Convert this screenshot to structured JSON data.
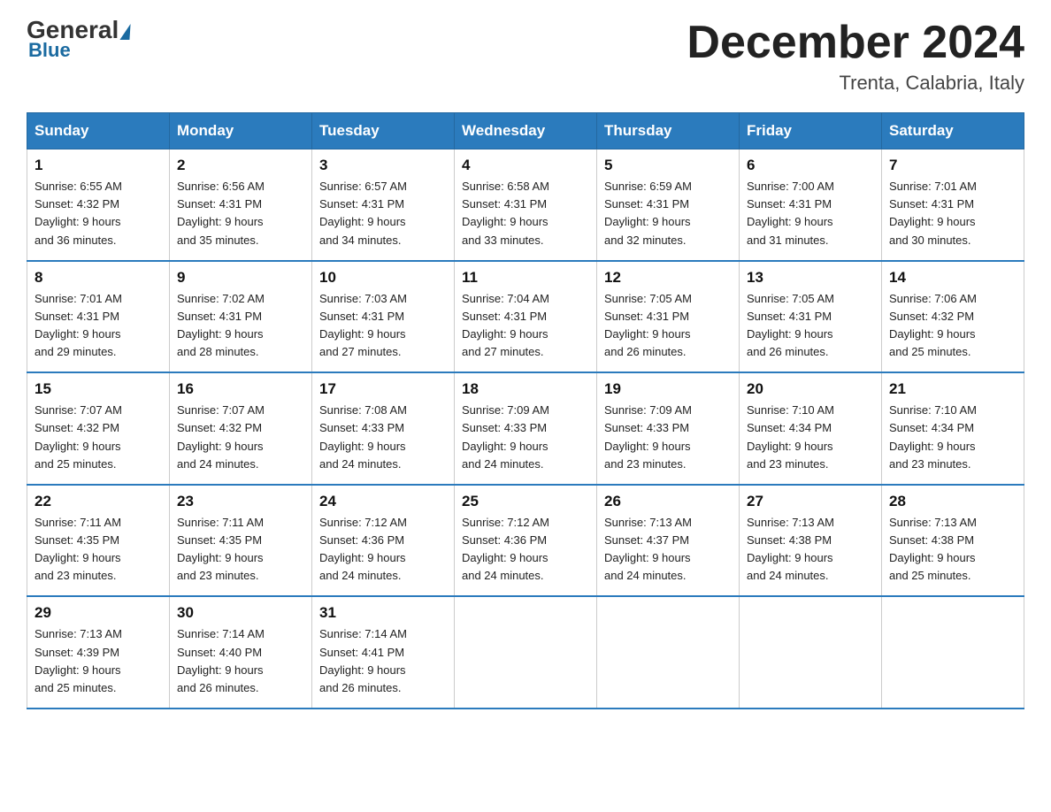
{
  "logo": {
    "general": "General",
    "blue": "Blue",
    "triangle_char": "▶"
  },
  "title": "December 2024",
  "location": "Trenta, Calabria, Italy",
  "days_of_week": [
    "Sunday",
    "Monday",
    "Tuesday",
    "Wednesday",
    "Thursday",
    "Friday",
    "Saturday"
  ],
  "weeks": [
    [
      {
        "day": "1",
        "sunrise": "6:55 AM",
        "sunset": "4:32 PM",
        "daylight": "9 hours and 36 minutes."
      },
      {
        "day": "2",
        "sunrise": "6:56 AM",
        "sunset": "4:31 PM",
        "daylight": "9 hours and 35 minutes."
      },
      {
        "day": "3",
        "sunrise": "6:57 AM",
        "sunset": "4:31 PM",
        "daylight": "9 hours and 34 minutes."
      },
      {
        "day": "4",
        "sunrise": "6:58 AM",
        "sunset": "4:31 PM",
        "daylight": "9 hours and 33 minutes."
      },
      {
        "day": "5",
        "sunrise": "6:59 AM",
        "sunset": "4:31 PM",
        "daylight": "9 hours and 32 minutes."
      },
      {
        "day": "6",
        "sunrise": "7:00 AM",
        "sunset": "4:31 PM",
        "daylight": "9 hours and 31 minutes."
      },
      {
        "day": "7",
        "sunrise": "7:01 AM",
        "sunset": "4:31 PM",
        "daylight": "9 hours and 30 minutes."
      }
    ],
    [
      {
        "day": "8",
        "sunrise": "7:01 AM",
        "sunset": "4:31 PM",
        "daylight": "9 hours and 29 minutes."
      },
      {
        "day": "9",
        "sunrise": "7:02 AM",
        "sunset": "4:31 PM",
        "daylight": "9 hours and 28 minutes."
      },
      {
        "day": "10",
        "sunrise": "7:03 AM",
        "sunset": "4:31 PM",
        "daylight": "9 hours and 27 minutes."
      },
      {
        "day": "11",
        "sunrise": "7:04 AM",
        "sunset": "4:31 PM",
        "daylight": "9 hours and 27 minutes."
      },
      {
        "day": "12",
        "sunrise": "7:05 AM",
        "sunset": "4:31 PM",
        "daylight": "9 hours and 26 minutes."
      },
      {
        "day": "13",
        "sunrise": "7:05 AM",
        "sunset": "4:31 PM",
        "daylight": "9 hours and 26 minutes."
      },
      {
        "day": "14",
        "sunrise": "7:06 AM",
        "sunset": "4:32 PM",
        "daylight": "9 hours and 25 minutes."
      }
    ],
    [
      {
        "day": "15",
        "sunrise": "7:07 AM",
        "sunset": "4:32 PM",
        "daylight": "9 hours and 25 minutes."
      },
      {
        "day": "16",
        "sunrise": "7:07 AM",
        "sunset": "4:32 PM",
        "daylight": "9 hours and 24 minutes."
      },
      {
        "day": "17",
        "sunrise": "7:08 AM",
        "sunset": "4:33 PM",
        "daylight": "9 hours and 24 minutes."
      },
      {
        "day": "18",
        "sunrise": "7:09 AM",
        "sunset": "4:33 PM",
        "daylight": "9 hours and 24 minutes."
      },
      {
        "day": "19",
        "sunrise": "7:09 AM",
        "sunset": "4:33 PM",
        "daylight": "9 hours and 23 minutes."
      },
      {
        "day": "20",
        "sunrise": "7:10 AM",
        "sunset": "4:34 PM",
        "daylight": "9 hours and 23 minutes."
      },
      {
        "day": "21",
        "sunrise": "7:10 AM",
        "sunset": "4:34 PM",
        "daylight": "9 hours and 23 minutes."
      }
    ],
    [
      {
        "day": "22",
        "sunrise": "7:11 AM",
        "sunset": "4:35 PM",
        "daylight": "9 hours and 23 minutes."
      },
      {
        "day": "23",
        "sunrise": "7:11 AM",
        "sunset": "4:35 PM",
        "daylight": "9 hours and 23 minutes."
      },
      {
        "day": "24",
        "sunrise": "7:12 AM",
        "sunset": "4:36 PM",
        "daylight": "9 hours and 24 minutes."
      },
      {
        "day": "25",
        "sunrise": "7:12 AM",
        "sunset": "4:36 PM",
        "daylight": "9 hours and 24 minutes."
      },
      {
        "day": "26",
        "sunrise": "7:13 AM",
        "sunset": "4:37 PM",
        "daylight": "9 hours and 24 minutes."
      },
      {
        "day": "27",
        "sunrise": "7:13 AM",
        "sunset": "4:38 PM",
        "daylight": "9 hours and 24 minutes."
      },
      {
        "day": "28",
        "sunrise": "7:13 AM",
        "sunset": "4:38 PM",
        "daylight": "9 hours and 25 minutes."
      }
    ],
    [
      {
        "day": "29",
        "sunrise": "7:13 AM",
        "sunset": "4:39 PM",
        "daylight": "9 hours and 25 minutes."
      },
      {
        "day": "30",
        "sunrise": "7:14 AM",
        "sunset": "4:40 PM",
        "daylight": "9 hours and 26 minutes."
      },
      {
        "day": "31",
        "sunrise": "7:14 AM",
        "sunset": "4:41 PM",
        "daylight": "9 hours and 26 minutes."
      },
      null,
      null,
      null,
      null
    ]
  ],
  "labels": {
    "sunrise": "Sunrise:",
    "sunset": "Sunset:",
    "daylight": "Daylight:"
  }
}
